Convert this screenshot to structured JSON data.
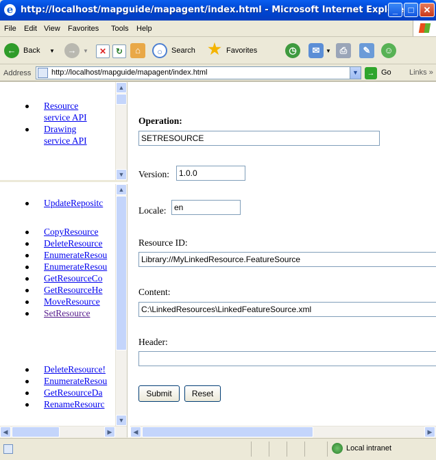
{
  "window": {
    "title": "http://localhost/mapguide/mapagent/index.html - Microsoft Internet Explorer"
  },
  "menu": [
    "File",
    "Edit",
    "View",
    "Favorites",
    "Tools",
    "Help"
  ],
  "toolbar": {
    "back_label": "Back",
    "search_label": "Search",
    "favorites_label": "Favorites"
  },
  "address": {
    "label": "Address",
    "url": "http://localhost/mapguide/mapagent/index.html",
    "go_label": "Go",
    "links_label": "Links"
  },
  "left_top": {
    "items": [
      {
        "label_line1": "Resource",
        "label_line2": "service API"
      },
      {
        "label_line1": "Drawing",
        "label_line2": "service API"
      }
    ]
  },
  "left_bottom": {
    "group1": [
      "UpdateRepositc"
    ],
    "group2": [
      "CopyResource",
      "DeleteResource",
      "EnumerateResou",
      "EnumerateResou",
      "GetResourceCo",
      "GetResourceHe",
      "MoveResource",
      "SetResource"
    ],
    "group3": [
      "DeleteResource!",
      "EnumerateResou",
      "GetResourceDa",
      "RenameResourc"
    ]
  },
  "form": {
    "operation_label": "Operation:",
    "operation_value": "SETRESOURCE",
    "version_label": "Version:",
    "version_value": "1.0.0",
    "locale_label": "Locale:",
    "locale_value": "en",
    "resource_id_label": "Resource ID:",
    "resource_id_value": "Library://MyLinkedResource.FeatureSource",
    "content_label": "Content:",
    "content_value": "C:\\LinkedResources\\LinkedFeatureSource.xml",
    "header_label": "Header:",
    "header_value": "",
    "submit_label": "Submit",
    "reset_label": "Reset"
  },
  "status": {
    "zone_label": "Local intranet"
  }
}
